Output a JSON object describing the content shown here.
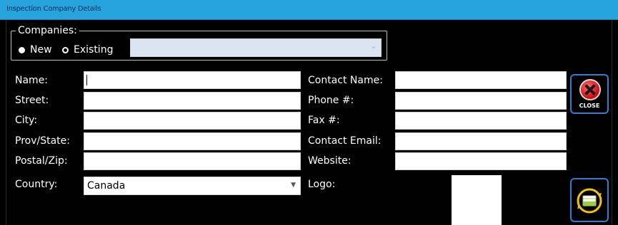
{
  "window": {
    "title": "Inspection Company Details"
  },
  "companies": {
    "legend": "Companies:",
    "radio_new": "New",
    "radio_existing": "Existing",
    "selected": "new",
    "existing_value": ""
  },
  "form": {
    "name_label": "Name:",
    "street_label": "Street:",
    "city_label": "City:",
    "prov_label": "Prov/State:",
    "postal_label": "Postal/Zip:",
    "country_label": "Country:",
    "country_value": "Canada",
    "contact_name_label": "Contact Name:",
    "phone_label": "Phone #:",
    "fax_label": "Fax #:",
    "email_label": "Contact Email:",
    "website_label": "Website:",
    "logo_label": "Logo:"
  },
  "buttons": {
    "close_label": "CLOSE",
    "close_icon": "close-icon",
    "save_icon": "save-icon"
  },
  "colors": {
    "titlebar": "#27a4de",
    "background": "#000000",
    "button_border": "#2f7fd0",
    "close_red": "#c90b0b"
  }
}
